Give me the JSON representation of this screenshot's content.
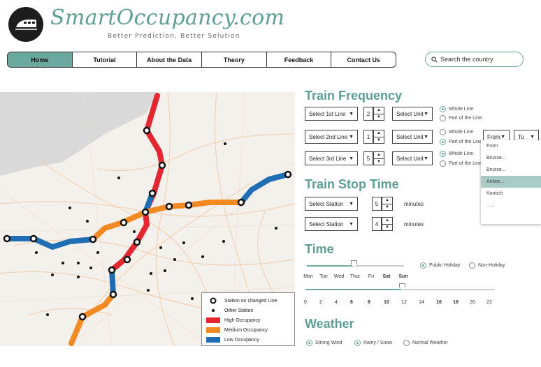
{
  "header": {
    "brand": "SmartOccupancy.com",
    "tagline": "Better Prediction, Better Solution",
    "logo_icon": "train-icon"
  },
  "nav": {
    "items": [
      "Home",
      "Tutorial",
      "About the Data",
      "Theory",
      "Feedback",
      "Contact Us"
    ],
    "active": "Home"
  },
  "search": {
    "placeholder": "Search the country"
  },
  "colors": {
    "accent": "#6aa79c",
    "high": "#e3262f",
    "medium": "#f28a21",
    "low": "#1f6db3"
  },
  "legend": {
    "station_changed": "Station on changed Line",
    "other_station": "Other Station",
    "high": "High Occupancy",
    "medium": "Medium Occupancy",
    "low": "Low Occupancy"
  },
  "train_frequency": {
    "title": "Train Frequency",
    "rows": [
      {
        "line": "Select 1st Line",
        "value": "2",
        "unit": "Select Unit",
        "opt1": "Whole Line",
        "opt2": "Part of the Line",
        "selected": "opt1"
      },
      {
        "line": "Select 2nd Line",
        "value": "1",
        "unit": "Select Unit",
        "opt1": "Whole Line",
        "opt2": "Part of the Line",
        "selected": "opt2"
      },
      {
        "line": "Select 3rd Line",
        "value": "5",
        "unit": "Select Unit",
        "opt1": "Whole Line",
        "opt2": "Part of the Line",
        "selected": "opt1"
      }
    ],
    "from_label": "From",
    "to_label": "To",
    "from_options": [
      "From",
      "Brusse...",
      "Brusse...",
      "Antwe...",
      "Kontich",
      "......"
    ],
    "highlighted_option": "Antwe..."
  },
  "train_stop_time": {
    "title": "Train Stop Time",
    "rows": [
      {
        "station": "Select Station",
        "value": "5",
        "unit": "minutes"
      },
      {
        "station": "Select Station",
        "value": "4",
        "unit": "minutes"
      }
    ]
  },
  "time": {
    "title": "Time",
    "days": [
      "Mon",
      "Tue",
      "Wed",
      "Thur",
      "Fri",
      "Sat",
      "Sun"
    ],
    "selected_day": "Thur",
    "holiday": {
      "public": "Public Holiday",
      "non": "Non-Holiday",
      "selected": "public"
    },
    "hours": [
      "0",
      "2",
      "4",
      "6",
      "8",
      "10",
      "12",
      "14",
      "16",
      "18",
      "20",
      "22"
    ],
    "selected_hour": "12"
  },
  "weather": {
    "title": "Weather",
    "options": [
      "Strong Wind",
      "Rainy / Snow",
      "Normal Weather"
    ],
    "selected": "Rainy / Snow"
  }
}
